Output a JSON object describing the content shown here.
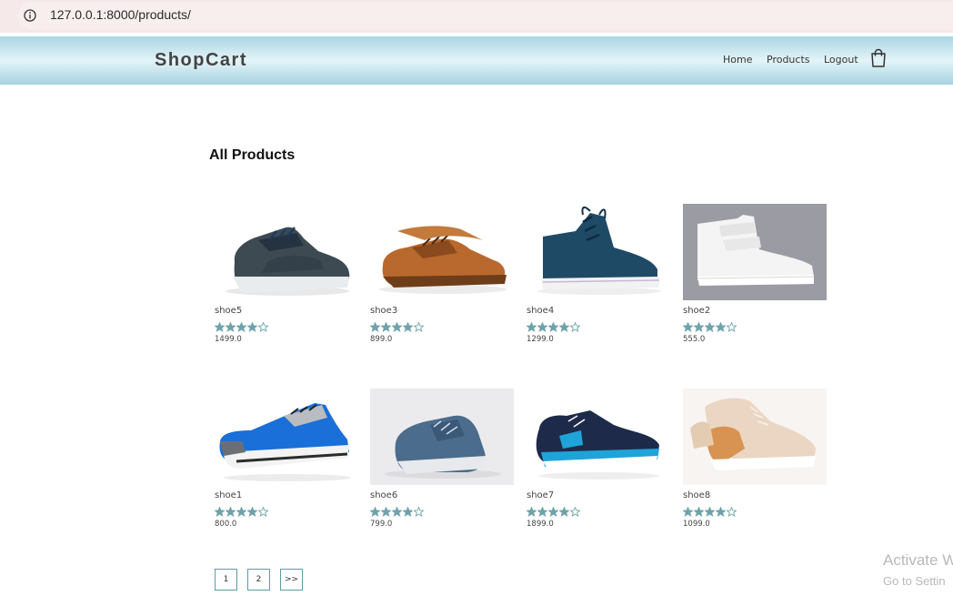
{
  "browser": {
    "url": "127.0.0.1:8000/products/"
  },
  "header": {
    "brand": "ShopCart",
    "nav": {
      "home": "Home",
      "products": "Products",
      "logout": "Logout"
    },
    "cart_icon": "shopping-bag-icon"
  },
  "main": {
    "title": "All Products",
    "products": [
      {
        "name": "shoe5",
        "price": "1499.0",
        "rating": 4,
        "max_rating": 5,
        "image": "dark-grey-sneaker"
      },
      {
        "name": "shoe3",
        "price": "899.0",
        "rating": 4,
        "max_rating": 5,
        "image": "brown-oxford-shoe"
      },
      {
        "name": "shoe4",
        "price": "1299.0",
        "rating": 4,
        "max_rating": 5,
        "image": "navy-high-top-sneaker"
      },
      {
        "name": "shoe2",
        "price": "555.0",
        "rating": 4,
        "max_rating": 5,
        "image": "white-high-top-sneaker"
      },
      {
        "name": "shoe1",
        "price": "800.0",
        "rating": 4,
        "max_rating": 5,
        "image": "blue-running-shoe"
      },
      {
        "name": "shoe6",
        "price": "799.0",
        "rating": 4,
        "max_rating": 5,
        "image": "blue-slip-on-shoe"
      },
      {
        "name": "shoe7",
        "price": "1899.0",
        "rating": 4,
        "max_rating": 5,
        "image": "navy-cyan-trainer"
      },
      {
        "name": "shoe8",
        "price": "1099.0",
        "rating": 4,
        "max_rating": 5,
        "image": "beige-casual-sneaker"
      }
    ],
    "pagination": [
      "1",
      "2",
      ">>"
    ]
  },
  "watermark": {
    "title": "Activate W",
    "subtitle": "Go to Settin"
  },
  "colors": {
    "star": "#6ea3ab",
    "page_border": "#5b9da8",
    "navbar": "#a9d5e3"
  }
}
